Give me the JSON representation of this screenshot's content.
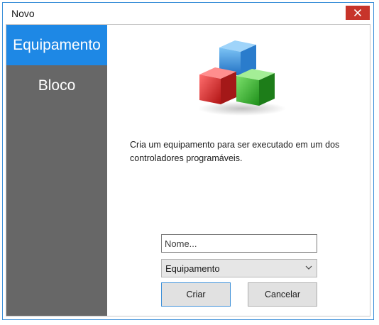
{
  "window": {
    "title": "Novo"
  },
  "sidebar": {
    "items": [
      {
        "label": "Equipamento",
        "active": true
      },
      {
        "label": "Bloco",
        "active": false
      }
    ]
  },
  "content": {
    "logo_icon": "colored-cubes-icon",
    "description": "Cria um equipamento para ser executado em um dos controladores programáveis.",
    "name_input": {
      "value": "",
      "placeholder": "Nome..."
    },
    "type_select": {
      "selected": "Equipamento"
    },
    "buttons": {
      "create": "Criar",
      "cancel": "Cancelar"
    }
  },
  "colors": {
    "accent": "#1e88e5",
    "sidebar": "#676767",
    "close": "#c7342a"
  }
}
